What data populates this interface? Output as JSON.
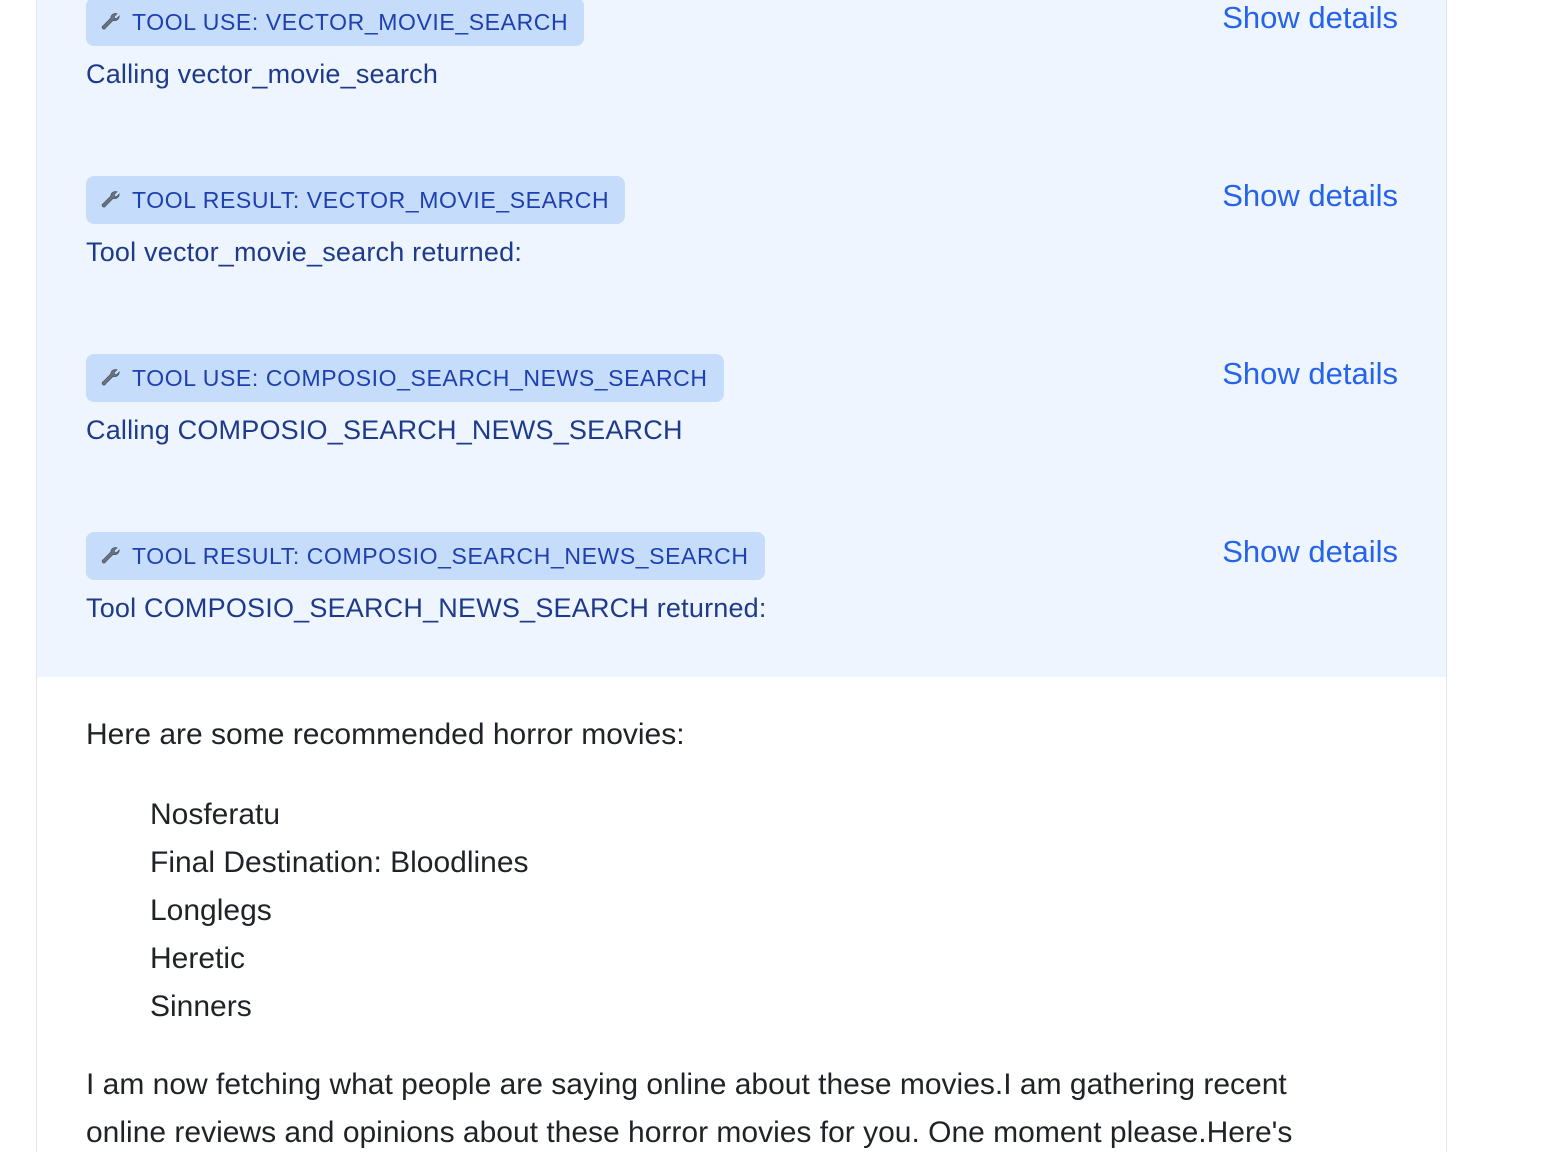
{
  "tool_calls": [
    {
      "badge": "TOOL USE: VECTOR_MOVIE_SEARCH",
      "description": "Calling vector_movie_search",
      "action": "Show details"
    },
    {
      "badge": "TOOL RESULT: VECTOR_MOVIE_SEARCH",
      "description": "Tool vector_movie_search returned:",
      "action": "Show details"
    },
    {
      "badge": "TOOL USE: COMPOSIO_SEARCH_NEWS_SEARCH",
      "description": "Calling COMPOSIO_SEARCH_NEWS_SEARCH",
      "action": "Show details"
    },
    {
      "badge": "TOOL RESULT: COMPOSIO_SEARCH_NEWS_SEARCH",
      "description": "Tool COMPOSIO_SEARCH_NEWS_SEARCH returned:",
      "action": "Show details"
    }
  ],
  "answer": {
    "intro": "Here are some recommended horror movies:",
    "movies": [
      "Nosferatu",
      "Final Destination: Bloodlines",
      "Longlegs",
      "Heretic",
      "Sinners"
    ],
    "followup_line1": "I am now fetching what people are saying online about these movies.I am gathering recent",
    "followup_line2": "online reviews and opinions about these horror movies for you. One moment please.Here's"
  },
  "colors": {
    "tool_panel_bg": "#eef5fe",
    "badge_bg": "#c6dcfb",
    "badge_text": "#1e40af",
    "link": "#2563eb",
    "body_text": "#1f2328"
  },
  "icons": {
    "badge_icon": "wrench-icon"
  }
}
